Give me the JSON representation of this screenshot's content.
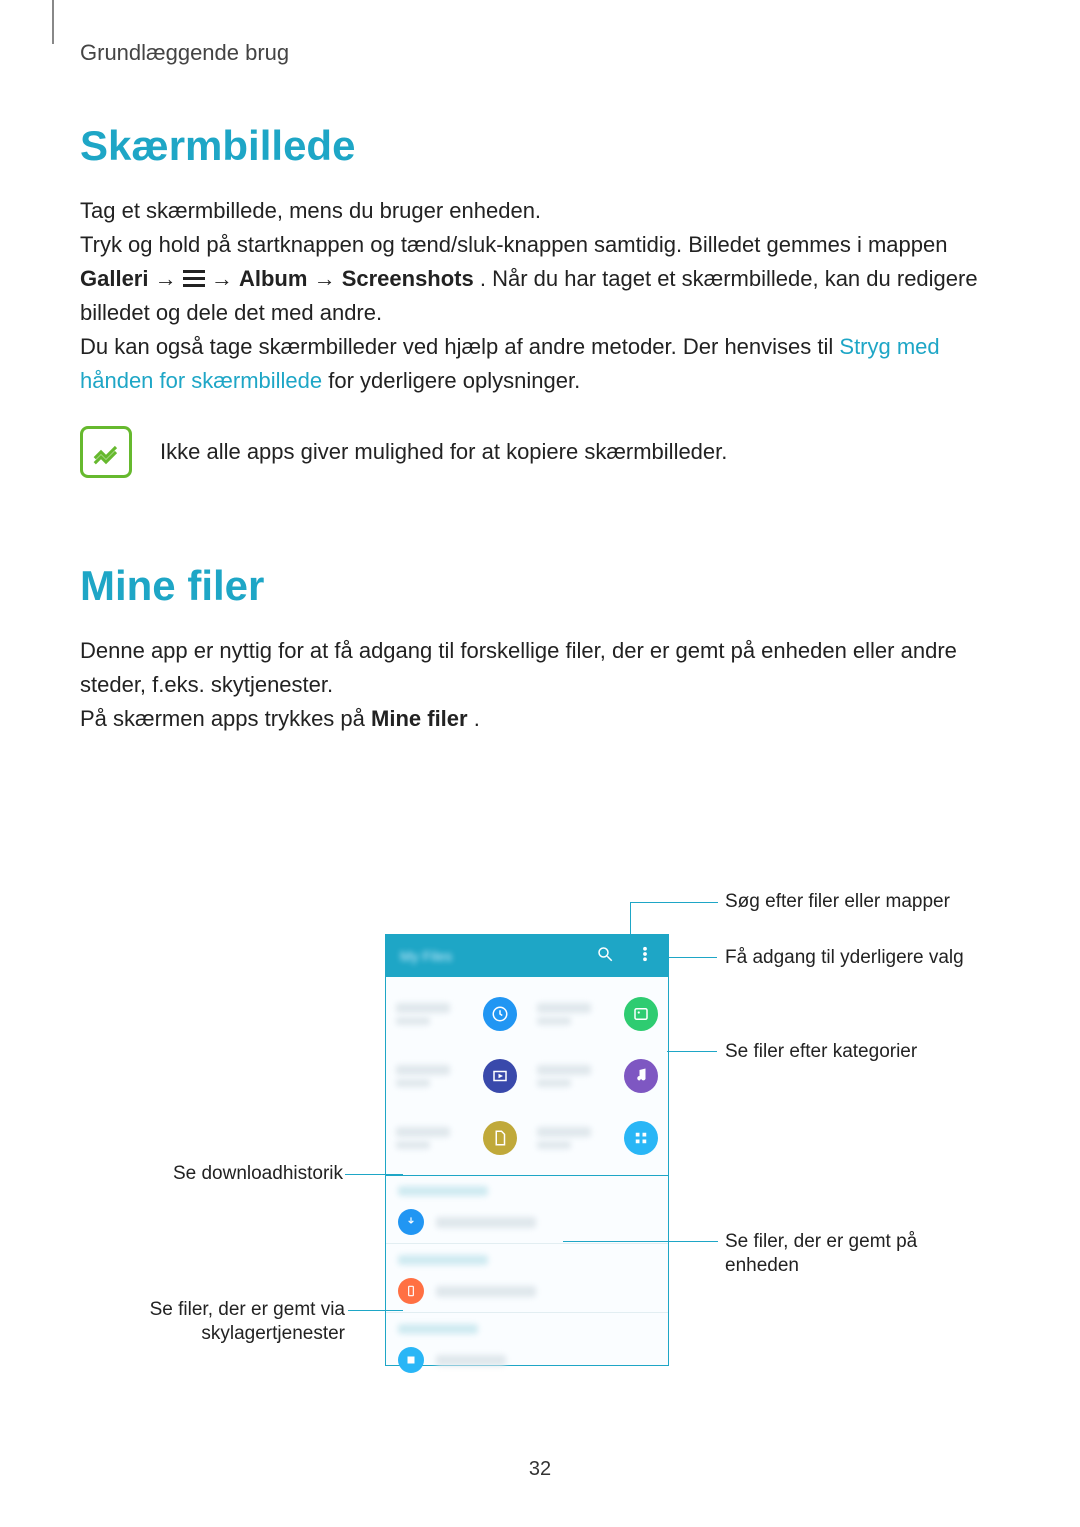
{
  "page": {
    "breadcrumb": "Grundlæggende brug",
    "page_number": "32"
  },
  "section1": {
    "heading": "Skærmbillede",
    "p1": "Tag et skærmbillede, mens du bruger enheden.",
    "p2a": "Tryk og hold på startknappen og tænd/sluk-knappen samtidig. Billedet gemmes i mappen ",
    "p2_b1": "Galleri",
    "p2_arrow": " → ",
    "p2_b2": "Album",
    "p2_b3": "Screenshots",
    "p2b": ". Når du har taget et skærmbillede, kan du redigere billedet og dele det med andre.",
    "p3a": "Du kan også tage skærmbilleder ved hjælp af andre metoder. Der henvises til ",
    "p3_link": "Stryg med hånden for skærmbillede",
    "p3b": " for yderligere oplysninger.",
    "note": "Ikke alle apps giver mulighed for at kopiere skærmbilleder."
  },
  "section2": {
    "heading": "Mine filer",
    "p1": "Denne app er nyttig for at få adgang til forskellige filer, der er gemt på enheden eller andre steder, f.eks. skytjenester.",
    "p2a": "På skærmen apps trykkes på ",
    "p2_b": "Mine filer",
    "p2b": "."
  },
  "callouts": {
    "c1": "Søg efter filer eller mapper",
    "c2": "Få adgang til yderligere valg",
    "c3": "Se filer efter kategorier",
    "c4": "Se filer, der er gemt på enheden",
    "c5": "Se downloadhistorik",
    "c6a": "Se filer, der er gemt via",
    "c6b": "skylagertjenester"
  }
}
